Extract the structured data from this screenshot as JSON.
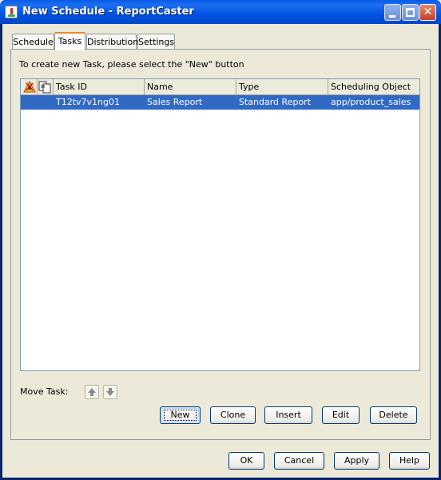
{
  "window": {
    "title": "New Schedule - ReportCaster",
    "controls": {
      "minimize": "minimize-icon",
      "maximize": "maximize-icon",
      "close": "close-icon"
    }
  },
  "tabs": [
    {
      "label": "Schedule",
      "active": false
    },
    {
      "label": "Tasks",
      "active": true
    },
    {
      "label": "Distribution",
      "active": false
    },
    {
      "label": "Settings",
      "active": false
    }
  ],
  "tasks_panel": {
    "instruction": "To create new Task, please select the \"New\" button",
    "table": {
      "icon_columns": [
        "alert-icon",
        "copy-icon"
      ],
      "columns": [
        "Task ID",
        "Name",
        "Type",
        "Scheduling Object"
      ],
      "rows": [
        {
          "task_id": "T12tv7v1ng01",
          "name": "Sales Report",
          "type": "Standard Report",
          "scheduling_object": "app/product_sales",
          "selected": true
        }
      ]
    },
    "move_task_label": "Move Task:",
    "move_buttons": [
      "arrow-up-icon",
      "arrow-down-icon"
    ],
    "actions": {
      "new": "New",
      "clone": "Clone",
      "insert": "Insert",
      "edit": "Edit",
      "delete": "Delete"
    }
  },
  "dialog_buttons": {
    "ok": "OK",
    "cancel": "Cancel",
    "apply": "Apply",
    "help": "Help"
  },
  "colors": {
    "selection": "#316AC5",
    "titlebar": "#0053E1",
    "active_tab_accent": "#E68B2C"
  }
}
